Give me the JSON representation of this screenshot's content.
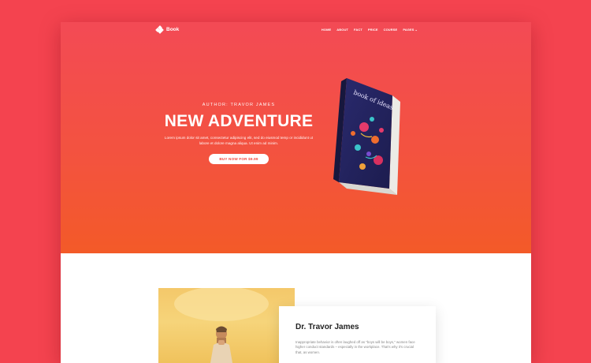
{
  "brand": {
    "name": "Book",
    "logo_icon": "diamond-grid-icon"
  },
  "nav": {
    "items": [
      "HOME",
      "ABOUT",
      "FACT",
      "PRICE",
      "COURSE"
    ],
    "dropdown_label": "PAGES",
    "dropdown_icon": "chevron-down-icon"
  },
  "hero": {
    "author": "AUTHOR: TRAVOR JAMES",
    "title": "NEW ADVENTURE",
    "description": "Lorem ipsum dolor sit amet, consectetur adipiscing elit, sed do eiusmod temp or incididunt ut labore et dolore magna aliqua. Ut enim ad minim.",
    "cta_label": "BUY NOW FOR $9.99",
    "book_cover_text": "book of ideas"
  },
  "about": {
    "name": "Dr. Travor James",
    "bio": "Inappropriate behavior is often laughed off as \"boys will be boys,\" women face higher conduct standards – especially in the workplace. That's why it's crucial that, as women."
  },
  "colors": {
    "page_background": "#f4434f",
    "hero_gradient_top": "#f34a55",
    "hero_gradient_bottom": "#f35a28",
    "cta_text": "#f2473d"
  }
}
